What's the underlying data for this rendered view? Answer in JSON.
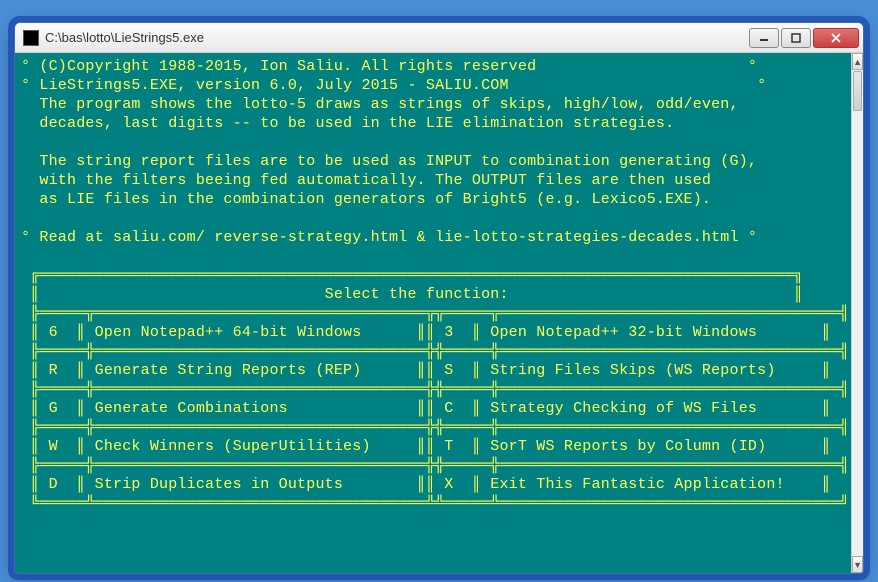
{
  "window": {
    "title": "C:\\bas\\lotto\\LieStrings5.exe"
  },
  "lines": {
    "l0": "° (C)Copyright 1988-2015, Ion Saliu. All rights reserved                       °",
    "l1": "° LieStrings5.EXE, version 6.0, July 2015 - SALIU.COM                           °",
    "l2": "  The program shows the lotto-5 draws as strings of skips, high/low, odd/even,",
    "l3": "  decades, last digits -- to be used in the LIE elimination strategies.",
    "l4": "",
    "l5": "  The string report files are to be used as INPUT to combination generating (G),",
    "l6": "  with the filters beeing fed automatically. The OUTPUT files are then used",
    "l7": "  as LIE files in the combination generators of Bright5 (e.g. Lexico5.EXE).",
    "l8": "",
    "l9": "° Read at saliu.com/ reverse-strategy.html & lie-lotto-strategies-decades.html °"
  },
  "menu": {
    "header": "Select the function:",
    "items": [
      {
        "key": "6",
        "label": "Open Notepad++ 64-bit Windows"
      },
      {
        "key": "3",
        "label": "Open Notepad++ 32-bit Windows"
      },
      {
        "key": "R",
        "label": "Generate String Reports (REP)"
      },
      {
        "key": "S",
        "label": "String Files Skips (WS Reports)"
      },
      {
        "key": "G",
        "label": "Generate Combinations"
      },
      {
        "key": "C",
        "label": "Strategy Checking of WS Files"
      },
      {
        "key": "W",
        "label": "Check Winners (SuperUtilities)"
      },
      {
        "key": "T",
        "label": "SorT WS Reports by Column (ID)"
      },
      {
        "key": "D",
        "label": "Strip Duplicates in Outputs"
      },
      {
        "key": "X",
        "label": "Exit This Fantastic Application!"
      }
    ]
  }
}
